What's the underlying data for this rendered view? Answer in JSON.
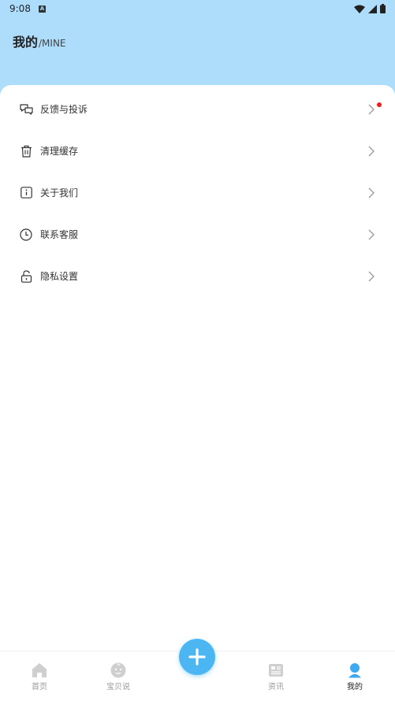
{
  "status_bar": {
    "time": "9:08",
    "badge": "A"
  },
  "header": {
    "title": "我的",
    "subtitle": "/MINE"
  },
  "menu": {
    "items": [
      {
        "label": "反馈与投诉",
        "icon": "chat-bubbles-icon",
        "has_badge": true
      },
      {
        "label": "清理缓存",
        "icon": "trash-icon",
        "has_badge": false
      },
      {
        "label": "关于我们",
        "icon": "info-icon",
        "has_badge": false
      },
      {
        "label": "联系客服",
        "icon": "clock-icon",
        "has_badge": false
      },
      {
        "label": "隐私设置",
        "icon": "lock-icon",
        "has_badge": false
      }
    ]
  },
  "tabbar": {
    "tabs": [
      {
        "label": "首页",
        "icon": "home-icon",
        "active": false
      },
      {
        "label": "宝贝说",
        "icon": "baby-face-icon",
        "active": false
      },
      {
        "label": "资讯",
        "icon": "news-icon",
        "active": false
      },
      {
        "label": "我的",
        "icon": "person-icon",
        "active": true
      }
    ],
    "fab_icon": "plus-icon"
  },
  "colors": {
    "header_bg": "#aedcfb",
    "accent": "#4cb6f2",
    "badge": "#ee1c1c"
  }
}
